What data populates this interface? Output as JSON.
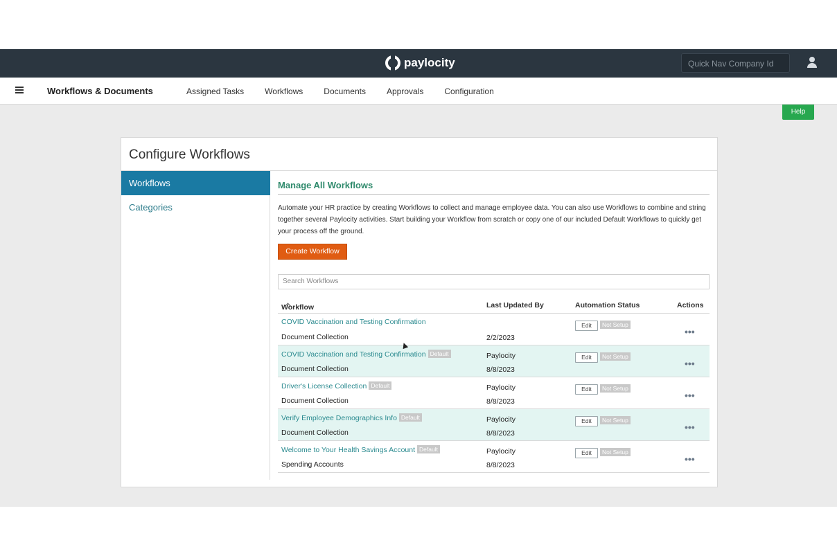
{
  "topbar": {
    "brand": "paylocity",
    "quicknav_placeholder": "Quick Nav Company Id"
  },
  "subnav": {
    "app_title": "Workflows & Documents",
    "links": [
      "Assigned Tasks",
      "Workflows",
      "Documents",
      "Approvals",
      "Configuration"
    ]
  },
  "help_label": "Help",
  "card": {
    "title": "Configure Workflows",
    "leftnav": {
      "active": "Workflows",
      "item": "Categories"
    },
    "main": {
      "title": "Manage All Workflows",
      "description": "Automate your HR practice by creating Workflows to collect and manage employee data. You can also use Workflows to combine and string together several Paylocity activities. Start building your Workflow from scratch or copy one of our included Default Workflows to quickly get your process off the ground.",
      "create_button": "Create Workflow",
      "search_placeholder": "Search Workflows",
      "columns": [
        "Workflow",
        "Last Updated By",
        "Automation Status",
        "Actions"
      ],
      "rows": [
        {
          "name": "COVID Vaccination and Testing Confirmation",
          "badge": "",
          "category": "Document Collection",
          "updated_by": "",
          "date": "2/2/2023",
          "edit": "Edit",
          "status": "Not Setup",
          "actions": "•••"
        },
        {
          "name": "COVID Vaccination and Testing Confirmation",
          "badge": "Default",
          "category": "Document Collection",
          "updated_by": "Paylocity",
          "date": "8/8/2023",
          "edit": "Edit",
          "status": "Not Setup",
          "actions": "•••"
        },
        {
          "name": "Driver's License Collection",
          "badge": "Default",
          "category": "Document Collection",
          "updated_by": "Paylocity",
          "date": "8/8/2023",
          "edit": "Edit",
          "status": "Not Setup",
          "actions": "•••"
        },
        {
          "name": "Verify Employee Demographics Info",
          "badge": "Default",
          "category": "Document Collection",
          "updated_by": "Paylocity",
          "date": "8/8/2023",
          "edit": "Edit",
          "status": "Not Setup",
          "actions": "•••"
        },
        {
          "name": "Welcome to Your Health Savings Account",
          "badge": "Default",
          "category": "Spending Accounts",
          "updated_by": "Paylocity",
          "date": "8/8/2023",
          "edit": "Edit",
          "status": "Not Setup",
          "actions": "•••"
        }
      ]
    }
  },
  "colors": {
    "topbar": "#2b3640",
    "accent_teal": "#1a7aa3",
    "create_orange": "#e05c12",
    "help_green": "#27a84f",
    "row_highlight": "#e3f5f2"
  },
  "icons": [
    "paylocity-logo-icon",
    "user-icon",
    "hamburger-menu-icon",
    "sort-ascending-icon",
    "more-actions-icon"
  ]
}
